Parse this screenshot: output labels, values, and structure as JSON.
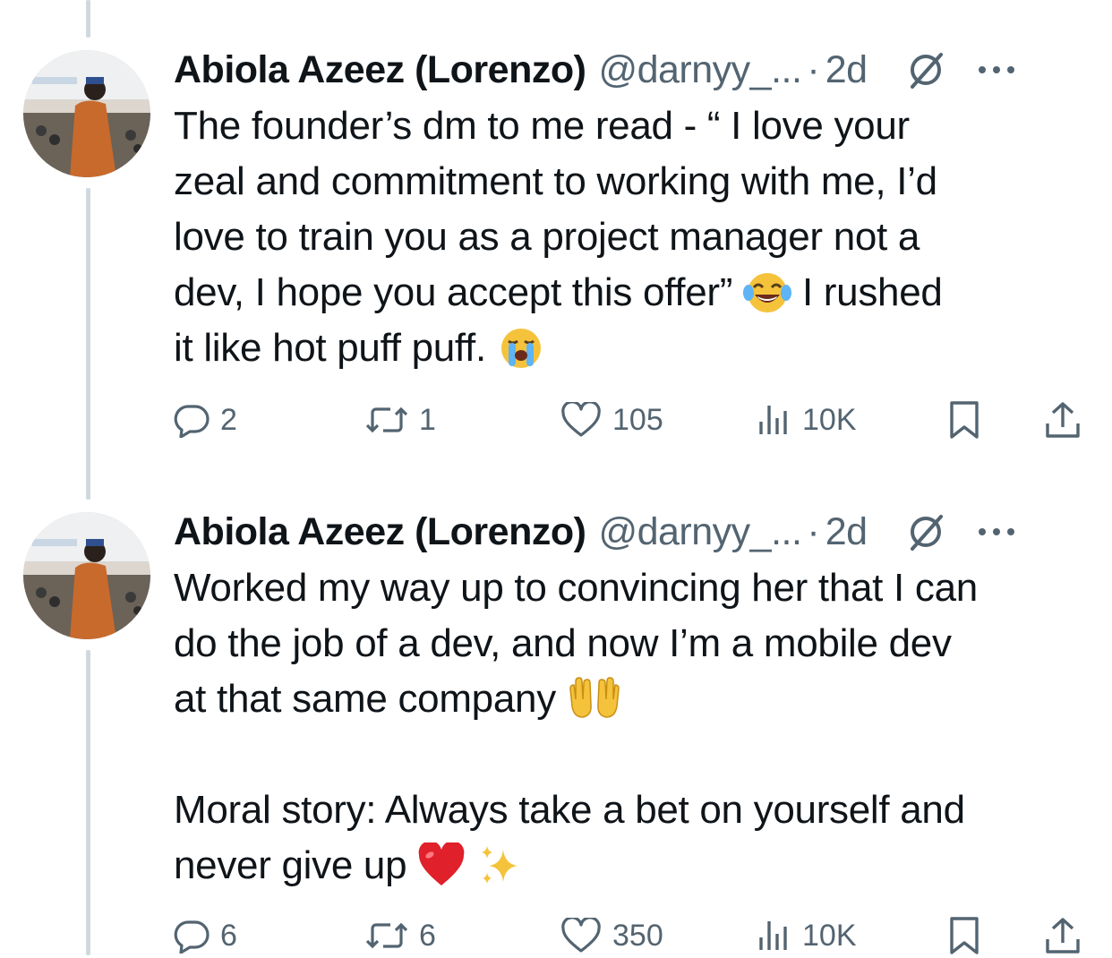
{
  "tweets": [
    {
      "author_name": "Abiola Azeez (Lorenzo)",
      "handle": "@darnyy_...",
      "separator": "·",
      "time": "2d",
      "text_parts": [
        "The founder’s dm to me read - “ I love your\nzeal and commitment to working with me, I’d\nlove to train you as a project manager not a\ndev, I hope you accept this offer” ",
        " I rushed\nit like hot puff puff. "
      ],
      "emojis": [
        "face-with-tears-of-joy",
        "loudly-crying-face"
      ],
      "replies": "2",
      "reposts": "1",
      "likes": "105",
      "views": "10K"
    },
    {
      "author_name": "Abiola Azeez (Lorenzo)",
      "handle": "@darnyy_...",
      "separator": "·",
      "time": "2d",
      "text_parts": [
        "Worked my way up to convincing her that I can\ndo the job of a dev, and now I’m a mobile dev\nat that same company ",
        "\n\nMoral story: Always take a bet on yourself and\nnever give up ",
        " "
      ],
      "emojis": [
        "palms-up-together",
        "red-heart",
        "sparkles"
      ],
      "replies": "6",
      "reposts": "6",
      "likes": "350",
      "views": "10K"
    }
  ],
  "icons": {
    "reply": "reply-icon",
    "repost": "repost-icon",
    "like": "heart-icon",
    "views": "views-icon",
    "bookmark": "bookmark-icon",
    "share": "share-icon",
    "grok": "grok-icon",
    "more": "more-icon"
  },
  "colors": {
    "text": "#0f1419",
    "secondary": "#536471",
    "thread_line": "#cfd9de"
  }
}
